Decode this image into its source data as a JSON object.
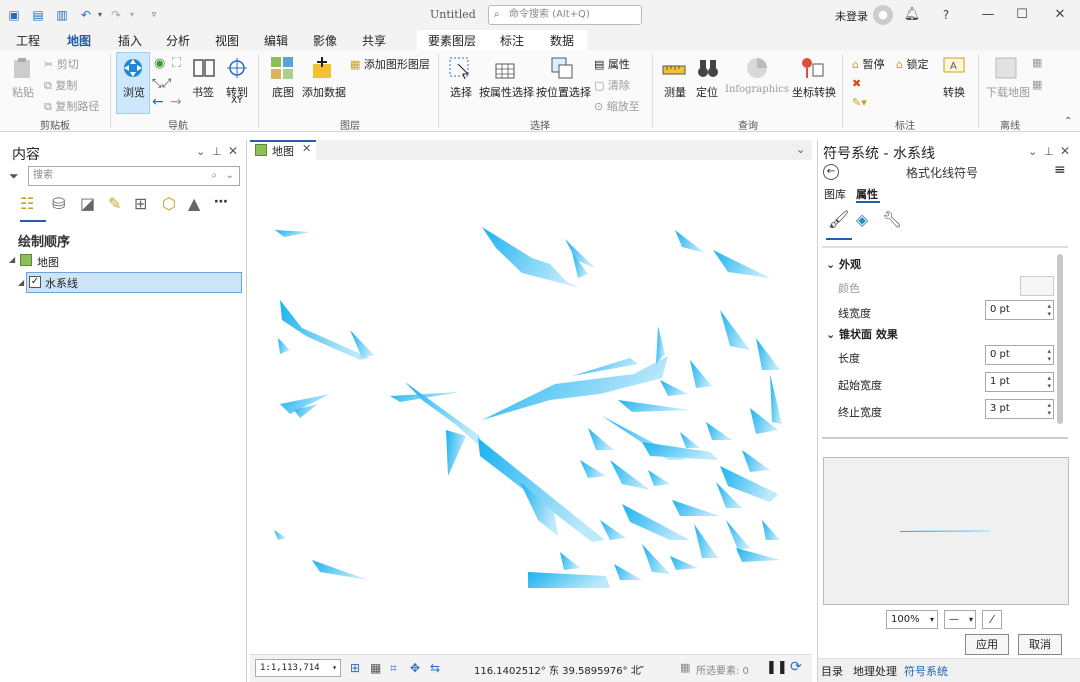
{
  "titlebar": {
    "title": "Untitled",
    "search_placeholder": "命令搜索 (Alt+Q)",
    "login": "未登录",
    "help": "?"
  },
  "tabs": [
    "工程",
    "地图",
    "插入",
    "分析",
    "视图",
    "编辑",
    "影像",
    "共享",
    "要素图层",
    "标注",
    "数据"
  ],
  "active_tab": "地图",
  "ribbon": {
    "clipboard": {
      "paste": "粘贴",
      "cut": "剪切",
      "copy": "复制",
      "copy_path": "复制路径",
      "group": "剪贴板"
    },
    "navigate": {
      "explore": "浏览",
      "bookmarks": "书签",
      "goto": "转到",
      "goto_xy": "XY",
      "group": "导航"
    },
    "layer": {
      "basemap": "底图",
      "add_data": "添加数据",
      "add_graphics": "添加图形图层",
      "group": "图层"
    },
    "selection": {
      "select": "选择",
      "by_attr": "按属性选择",
      "by_loc": "按位置选择",
      "attributes": "属性",
      "clear": "清除",
      "zoom_to": "缩放至",
      "group": "选择"
    },
    "inquiry": {
      "measure": "测量",
      "locate": "定位",
      "infographics": "Infographics",
      "coord": "坐标转换",
      "group": "查询"
    },
    "labeling": {
      "pause": "暂停",
      "lock": "锁定",
      "convert": "转换",
      "group": "标注"
    },
    "offline": {
      "download": "下载地图",
      "group": "离线"
    }
  },
  "contents": {
    "title": "内容",
    "search_placeholder": "搜索",
    "drawing_order": "绘制顺序",
    "map_item": "地图",
    "layer_item": "水系线"
  },
  "map": {
    "tab_label": "地图",
    "scale": "1:1,113,714",
    "coords": "116.1402512° 东  39.5895976° 北",
    "selected": "所选要素: 0",
    "water_color": "#17b4f0"
  },
  "symbology": {
    "title": "符号系统 - 水系线",
    "subtitle": "格式化线符号",
    "tab_gallery": "图库",
    "tab_properties": "属性",
    "section_appearance": "外观",
    "color_label": "颜色",
    "line_width_label": "线宽度",
    "line_width_value": "0 pt",
    "section_tapered": "锥状面 效果",
    "length_label": "长度",
    "length_value": "0 pt",
    "start_width_label": "起始宽度",
    "start_width_value": "1 pt",
    "end_width_label": "终止宽度",
    "end_width_value": "3 pt",
    "zoom": "100%",
    "apply": "应用",
    "cancel": "取消"
  },
  "bottom_tabs": [
    "目录",
    "地理处理",
    "符号系统"
  ]
}
